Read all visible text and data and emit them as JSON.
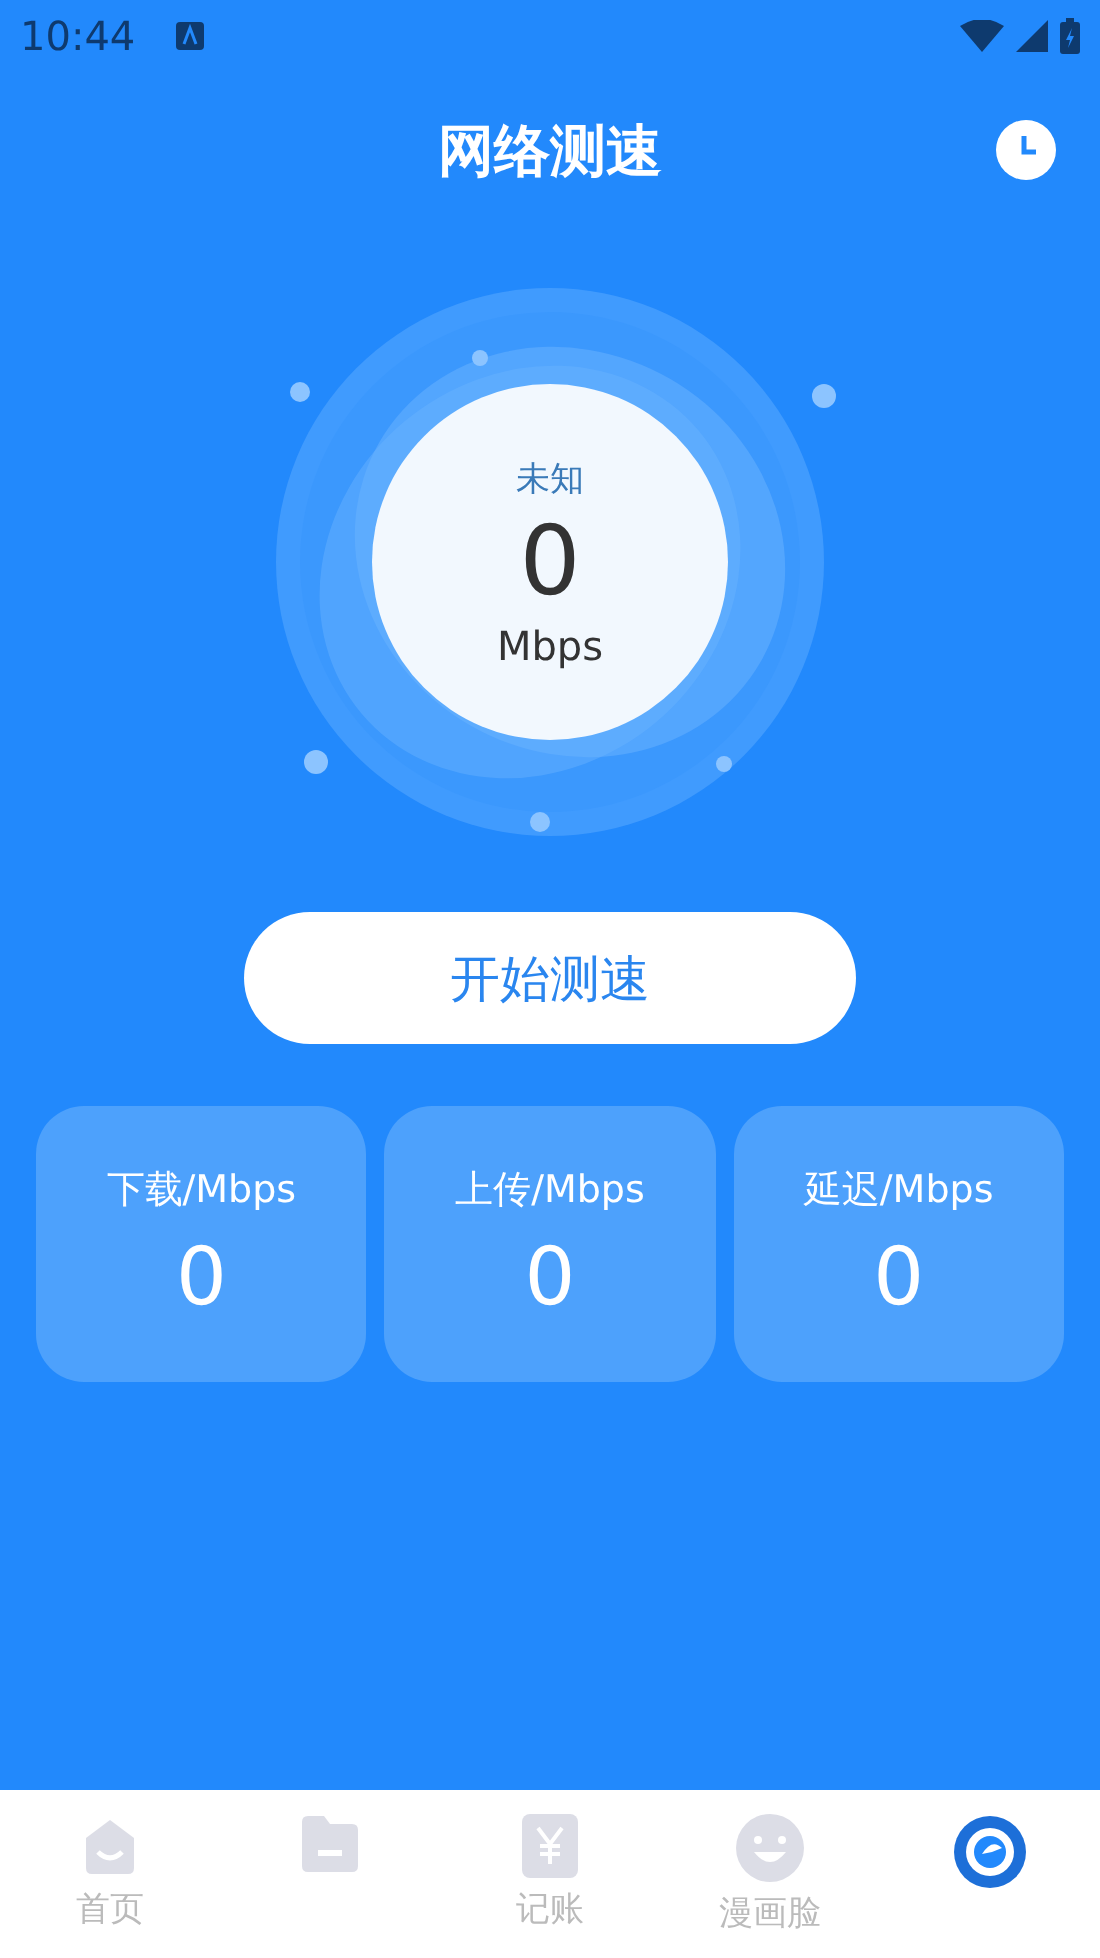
{
  "status_bar": {
    "time": "10:44"
  },
  "header": {
    "title": "网络测速"
  },
  "gauge": {
    "status": "未知",
    "value": "0",
    "unit": "Mbps"
  },
  "start_button": {
    "label": "开始测速"
  },
  "stats": [
    {
      "label": "下载/Mbps",
      "value": "0"
    },
    {
      "label": "上传/Mbps",
      "value": "0"
    },
    {
      "label": "延迟/Mbps",
      "value": "0"
    }
  ],
  "bottom_nav": [
    {
      "kind": "home",
      "label": "首页",
      "selected": false
    },
    {
      "kind": "folder",
      "selected": false
    },
    {
      "kind": "ledger",
      "label": "记账",
      "selected": false
    },
    {
      "kind": "face",
      "label": "漫画脸",
      "selected": false
    },
    {
      "kind": "speed",
      "selected": true
    }
  ]
}
